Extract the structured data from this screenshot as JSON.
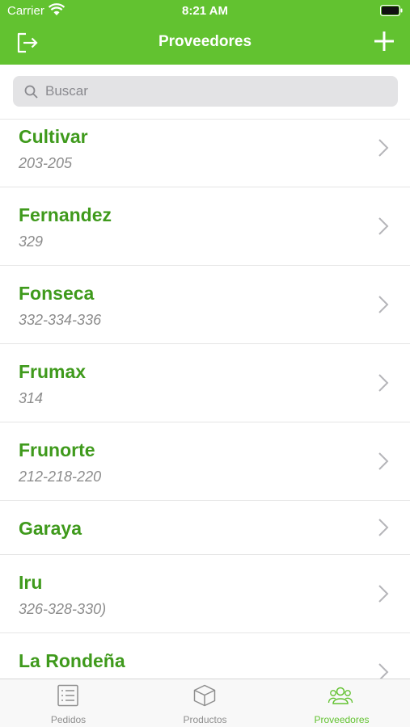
{
  "status_bar": {
    "carrier": "Carrier",
    "time": "8:21 AM"
  },
  "nav": {
    "title": "Proveedores"
  },
  "search": {
    "placeholder": "Buscar"
  },
  "providers": [
    {
      "name": "Cultivar",
      "codes": "203-205"
    },
    {
      "name": "Fernandez",
      "codes": "329"
    },
    {
      "name": "Fonseca",
      "codes": "332-334-336"
    },
    {
      "name": "Frumax",
      "codes": "314"
    },
    {
      "name": "Frunorte",
      "codes": "212-218-220"
    },
    {
      "name": "Garaya",
      "codes": ""
    },
    {
      "name": "Iru",
      "codes": "326-328-330)"
    },
    {
      "name": "La Rondeña",
      "codes": ""
    }
  ],
  "tabs": [
    {
      "label": "Pedidos",
      "icon": "list-icon"
    },
    {
      "label": "Productos",
      "icon": "box-icon"
    },
    {
      "label": "Proveedores",
      "icon": "people-icon",
      "active": true
    }
  ],
  "colors": {
    "accent": "#62c230",
    "title_green": "#3f9a1c",
    "subtitle_gray": "#8c8c8c"
  }
}
